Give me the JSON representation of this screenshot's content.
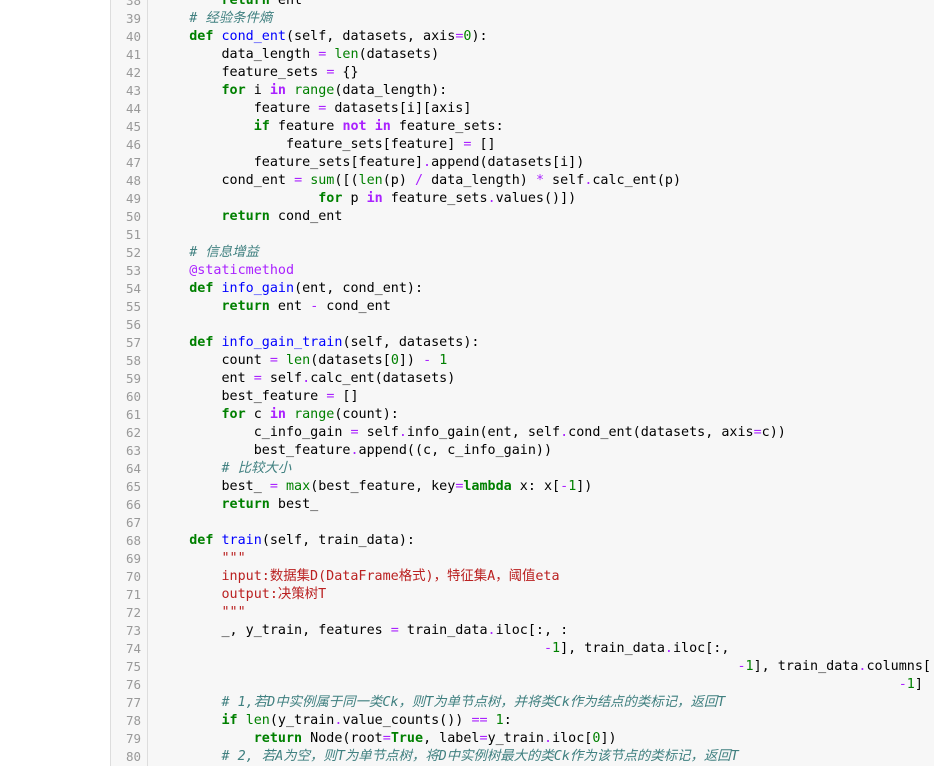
{
  "editor": {
    "lines": [
      {
        "no": "38",
        "tokens": [
          {
            "t": "        "
          },
          {
            "t": "return",
            "c": "kw"
          },
          {
            "t": " ent"
          }
        ]
      },
      {
        "no": "39",
        "tokens": [
          {
            "t": "    "
          },
          {
            "t": "# 经验条件熵",
            "c": "cm"
          }
        ]
      },
      {
        "no": "40",
        "tokens": [
          {
            "t": "    "
          },
          {
            "t": "def",
            "c": "kw"
          },
          {
            "t": " "
          },
          {
            "t": "cond_ent",
            "c": "fn"
          },
          {
            "t": "(self, datasets, axis"
          },
          {
            "t": "=",
            "c": "op"
          },
          {
            "t": "0",
            "c": "num"
          },
          {
            "t": "):"
          }
        ]
      },
      {
        "no": "41",
        "tokens": [
          {
            "t": "        data_length "
          },
          {
            "t": "=",
            "c": "op"
          },
          {
            "t": " "
          },
          {
            "t": "len",
            "c": "bi"
          },
          {
            "t": "(datasets)"
          }
        ]
      },
      {
        "no": "42",
        "tokens": [
          {
            "t": "        feature_sets "
          },
          {
            "t": "=",
            "c": "op"
          },
          {
            "t": " {}"
          }
        ]
      },
      {
        "no": "43",
        "tokens": [
          {
            "t": "        "
          },
          {
            "t": "for",
            "c": "kw"
          },
          {
            "t": " i "
          },
          {
            "t": "in",
            "c": "opw"
          },
          {
            "t": " "
          },
          {
            "t": "range",
            "c": "bi"
          },
          {
            "t": "(data_length):"
          }
        ]
      },
      {
        "no": "44",
        "tokens": [
          {
            "t": "            feature "
          },
          {
            "t": "=",
            "c": "op"
          },
          {
            "t": " datasets[i][axis]"
          }
        ]
      },
      {
        "no": "45",
        "tokens": [
          {
            "t": "            "
          },
          {
            "t": "if",
            "c": "kw"
          },
          {
            "t": " feature "
          },
          {
            "t": "not",
            "c": "opw"
          },
          {
            "t": " "
          },
          {
            "t": "in",
            "c": "opw"
          },
          {
            "t": " feature_sets:"
          }
        ]
      },
      {
        "no": "46",
        "tokens": [
          {
            "t": "                feature_sets[feature] "
          },
          {
            "t": "=",
            "c": "op"
          },
          {
            "t": " []"
          }
        ]
      },
      {
        "no": "47",
        "tokens": [
          {
            "t": "            feature_sets[feature]"
          },
          {
            "t": ".",
            "c": "op"
          },
          {
            "t": "append(datasets[i])"
          }
        ]
      },
      {
        "no": "48",
        "tokens": [
          {
            "t": "        cond_ent "
          },
          {
            "t": "=",
            "c": "op"
          },
          {
            "t": " "
          },
          {
            "t": "sum",
            "c": "bi"
          },
          {
            "t": "([("
          },
          {
            "t": "len",
            "c": "bi"
          },
          {
            "t": "(p) "
          },
          {
            "t": "/",
            "c": "op"
          },
          {
            "t": " data_length) "
          },
          {
            "t": "*",
            "c": "op"
          },
          {
            "t": " self"
          },
          {
            "t": ".",
            "c": "op"
          },
          {
            "t": "calc_ent(p)"
          }
        ]
      },
      {
        "no": "49",
        "tokens": [
          {
            "t": "                    "
          },
          {
            "t": "for",
            "c": "kw"
          },
          {
            "t": " p "
          },
          {
            "t": "in",
            "c": "opw"
          },
          {
            "t": " feature_sets"
          },
          {
            "t": ".",
            "c": "op"
          },
          {
            "t": "values()])"
          }
        ]
      },
      {
        "no": "50",
        "tokens": [
          {
            "t": "        "
          },
          {
            "t": "return",
            "c": "kw"
          },
          {
            "t": " cond_ent"
          }
        ]
      },
      {
        "no": "51",
        "tokens": []
      },
      {
        "no": "52",
        "tokens": [
          {
            "t": "    "
          },
          {
            "t": "# 信息增益",
            "c": "cm"
          }
        ]
      },
      {
        "no": "53",
        "tokens": [
          {
            "t": "    "
          },
          {
            "t": "@staticmethod",
            "c": "deco"
          }
        ]
      },
      {
        "no": "54",
        "tokens": [
          {
            "t": "    "
          },
          {
            "t": "def",
            "c": "kw"
          },
          {
            "t": " "
          },
          {
            "t": "info_gain",
            "c": "fn"
          },
          {
            "t": "(ent, cond_ent):"
          }
        ]
      },
      {
        "no": "55",
        "tokens": [
          {
            "t": "        "
          },
          {
            "t": "return",
            "c": "kw"
          },
          {
            "t": " ent "
          },
          {
            "t": "-",
            "c": "op"
          },
          {
            "t": " cond_ent"
          }
        ]
      },
      {
        "no": "56",
        "tokens": []
      },
      {
        "no": "57",
        "tokens": [
          {
            "t": "    "
          },
          {
            "t": "def",
            "c": "kw"
          },
          {
            "t": " "
          },
          {
            "t": "info_gain_train",
            "c": "fn"
          },
          {
            "t": "(self, datasets):"
          }
        ]
      },
      {
        "no": "58",
        "tokens": [
          {
            "t": "        count "
          },
          {
            "t": "=",
            "c": "op"
          },
          {
            "t": " "
          },
          {
            "t": "len",
            "c": "bi"
          },
          {
            "t": "(datasets["
          },
          {
            "t": "0",
            "c": "num"
          },
          {
            "t": "]) "
          },
          {
            "t": "-",
            "c": "op"
          },
          {
            "t": " "
          },
          {
            "t": "1",
            "c": "num"
          }
        ]
      },
      {
        "no": "59",
        "tokens": [
          {
            "t": "        ent "
          },
          {
            "t": "=",
            "c": "op"
          },
          {
            "t": " self"
          },
          {
            "t": ".",
            "c": "op"
          },
          {
            "t": "calc_ent(datasets)"
          }
        ]
      },
      {
        "no": "60",
        "tokens": [
          {
            "t": "        best_feature "
          },
          {
            "t": "=",
            "c": "op"
          },
          {
            "t": " []"
          }
        ]
      },
      {
        "no": "61",
        "tokens": [
          {
            "t": "        "
          },
          {
            "t": "for",
            "c": "kw"
          },
          {
            "t": " c "
          },
          {
            "t": "in",
            "c": "opw"
          },
          {
            "t": " "
          },
          {
            "t": "range",
            "c": "bi"
          },
          {
            "t": "(count):"
          }
        ]
      },
      {
        "no": "62",
        "tokens": [
          {
            "t": "            c_info_gain "
          },
          {
            "t": "=",
            "c": "op"
          },
          {
            "t": " self"
          },
          {
            "t": ".",
            "c": "op"
          },
          {
            "t": "info_gain(ent, self"
          },
          {
            "t": ".",
            "c": "op"
          },
          {
            "t": "cond_ent(datasets, axis"
          },
          {
            "t": "=",
            "c": "op"
          },
          {
            "t": "c))"
          }
        ]
      },
      {
        "no": "63",
        "tokens": [
          {
            "t": "            best_feature"
          },
          {
            "t": ".",
            "c": "op"
          },
          {
            "t": "append((c, c_info_gain))"
          }
        ]
      },
      {
        "no": "64",
        "tokens": [
          {
            "t": "        "
          },
          {
            "t": "# 比较大小",
            "c": "cm"
          }
        ]
      },
      {
        "no": "65",
        "tokens": [
          {
            "t": "        best_ "
          },
          {
            "t": "=",
            "c": "op"
          },
          {
            "t": " "
          },
          {
            "t": "max",
            "c": "bi"
          },
          {
            "t": "(best_feature, key"
          },
          {
            "t": "=",
            "c": "op"
          },
          {
            "t": "lambda",
            "c": "kw"
          },
          {
            "t": " x: x["
          },
          {
            "t": "-",
            "c": "op"
          },
          {
            "t": "1",
            "c": "num"
          },
          {
            "t": "])"
          }
        ]
      },
      {
        "no": "66",
        "tokens": [
          {
            "t": "        "
          },
          {
            "t": "return",
            "c": "kw"
          },
          {
            "t": " best_"
          }
        ]
      },
      {
        "no": "67",
        "tokens": []
      },
      {
        "no": "68",
        "tokens": [
          {
            "t": "    "
          },
          {
            "t": "def",
            "c": "kw"
          },
          {
            "t": " "
          },
          {
            "t": "train",
            "c": "fn"
          },
          {
            "t": "(self, train_data):"
          }
        ]
      },
      {
        "no": "69",
        "tokens": [
          {
            "t": "        "
          },
          {
            "t": "\"\"\"",
            "c": "sdoc"
          }
        ]
      },
      {
        "no": "70",
        "tokens": [
          {
            "t": "        "
          },
          {
            "t": "input:数据集D(DataFrame格式)，特征集A，阈值eta",
            "c": "str"
          }
        ]
      },
      {
        "no": "71",
        "tokens": [
          {
            "t": "        "
          },
          {
            "t": "output:决策树T",
            "c": "str"
          }
        ]
      },
      {
        "no": "72",
        "tokens": [
          {
            "t": "        "
          },
          {
            "t": "\"\"\"",
            "c": "sdoc"
          }
        ]
      },
      {
        "no": "73",
        "tokens": [
          {
            "t": "        _, y_train, features "
          },
          {
            "t": "=",
            "c": "op"
          },
          {
            "t": " train_data"
          },
          {
            "t": ".",
            "c": "op"
          },
          {
            "t": "iloc[:, :"
          }
        ]
      },
      {
        "no": "74",
        "tokens": [
          {
            "t": "                                                "
          },
          {
            "t": "-",
            "c": "op"
          },
          {
            "t": "1",
            "c": "num"
          },
          {
            "t": "], train_data"
          },
          {
            "t": ".",
            "c": "op"
          },
          {
            "t": "iloc[:,"
          }
        ]
      },
      {
        "no": "75",
        "tokens": [
          {
            "t": "                                                                        "
          },
          {
            "t": "-",
            "c": "op"
          },
          {
            "t": "1",
            "c": "num"
          },
          {
            "t": "], train_data"
          },
          {
            "t": ".",
            "c": "op"
          },
          {
            "t": "columns[:"
          }
        ]
      },
      {
        "no": "76",
        "tokens": [
          {
            "t": "                                                                                            "
          },
          {
            "t": "-",
            "c": "op"
          },
          {
            "t": "1",
            "c": "num"
          },
          {
            "t": "]"
          }
        ]
      },
      {
        "no": "77",
        "tokens": [
          {
            "t": "        "
          },
          {
            "t": "# 1,若D中实例属于同一类Ck，则T为单节点树，并将类Ck作为结点的类标记，返回T",
            "c": "cm"
          }
        ]
      },
      {
        "no": "78",
        "tokens": [
          {
            "t": "        "
          },
          {
            "t": "if",
            "c": "kw"
          },
          {
            "t": " "
          },
          {
            "t": "len",
            "c": "bi"
          },
          {
            "t": "(y_train"
          },
          {
            "t": ".",
            "c": "op"
          },
          {
            "t": "value_counts()) "
          },
          {
            "t": "==",
            "c": "op"
          },
          {
            "t": " "
          },
          {
            "t": "1",
            "c": "num"
          },
          {
            "t": ":"
          }
        ]
      },
      {
        "no": "79",
        "tokens": [
          {
            "t": "            "
          },
          {
            "t": "return",
            "c": "kw"
          },
          {
            "t": " Node(root"
          },
          {
            "t": "=",
            "c": "op"
          },
          {
            "t": "True",
            "c": "kwc"
          },
          {
            "t": ", label"
          },
          {
            "t": "=",
            "c": "op"
          },
          {
            "t": "y_train"
          },
          {
            "t": ".",
            "c": "op"
          },
          {
            "t": "iloc["
          },
          {
            "t": "0",
            "c": "num"
          },
          {
            "t": "])"
          }
        ]
      },
      {
        "no": "80",
        "tokens": [
          {
            "t": "        "
          },
          {
            "t": "# 2, 若A为空，则T为单节点树，将D中实例树最大的类Ck作为该节点的类标记，返回T",
            "c": "cm"
          }
        ]
      }
    ]
  }
}
